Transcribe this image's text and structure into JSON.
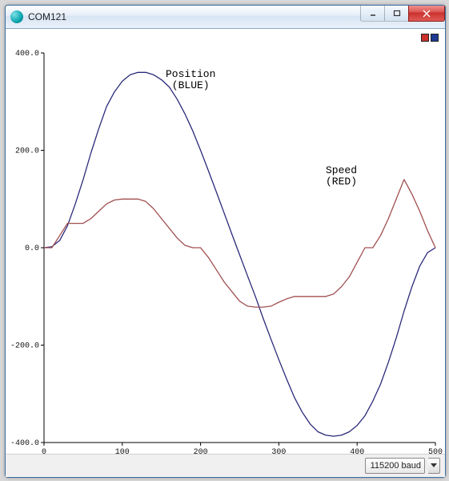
{
  "window": {
    "title": "COM121",
    "min_tooltip": "Minimize",
    "max_tooltip": "Maximize",
    "close_tooltip": "Close"
  },
  "legend": [
    "red",
    "blue"
  ],
  "annotations": {
    "position": "Position\n(BLUE)",
    "speed": "Speed\n(RED)"
  },
  "footer": {
    "baud_selected": "115200 baud"
  },
  "chart_data": {
    "type": "line",
    "xlabel": "",
    "ylabel": "",
    "xlim": [
      0,
      500
    ],
    "ylim": [
      -400,
      400
    ],
    "xticks": [
      0,
      100,
      200,
      300,
      400,
      500
    ],
    "yticks": [
      -400,
      -200,
      0,
      200,
      400
    ],
    "x": [
      0,
      10,
      20,
      30,
      40,
      50,
      60,
      70,
      80,
      90,
      100,
      110,
      120,
      130,
      140,
      150,
      160,
      170,
      180,
      190,
      200,
      210,
      220,
      230,
      240,
      250,
      260,
      270,
      280,
      290,
      300,
      310,
      320,
      330,
      340,
      350,
      360,
      370,
      380,
      390,
      400,
      410,
      420,
      430,
      440,
      450,
      460,
      470,
      480,
      490,
      500
    ],
    "series": [
      {
        "name": "Position (BLUE)",
        "color": "#2a2a7a",
        "values": [
          0,
          2,
          15,
          45,
          90,
          140,
          195,
          245,
          290,
          320,
          342,
          355,
          360,
          360,
          355,
          345,
          330,
          305,
          275,
          240,
          200,
          158,
          115,
          72,
          28,
          -15,
          -58,
          -100,
          -145,
          -188,
          -230,
          -270,
          -308,
          -338,
          -362,
          -378,
          -385,
          -387,
          -385,
          -378,
          -365,
          -345,
          -315,
          -280,
          -235,
          -185,
          -130,
          -80,
          -38,
          -10,
          0
        ]
      },
      {
        "name": "Speed (RED)",
        "color": "#a05050",
        "values": [
          0,
          0,
          25,
          50,
          50,
          50,
          60,
          75,
          90,
          98,
          100,
          100,
          100,
          95,
          80,
          60,
          40,
          20,
          5,
          0,
          0,
          -20,
          -45,
          -70,
          -90,
          -110,
          -120,
          -122,
          -122,
          -120,
          -112,
          -105,
          -100,
          -100,
          -100,
          -100,
          -100,
          -95,
          -80,
          -60,
          -30,
          0,
          0,
          25,
          60,
          100,
          140,
          110,
          75,
          35,
          0
        ]
      }
    ]
  }
}
